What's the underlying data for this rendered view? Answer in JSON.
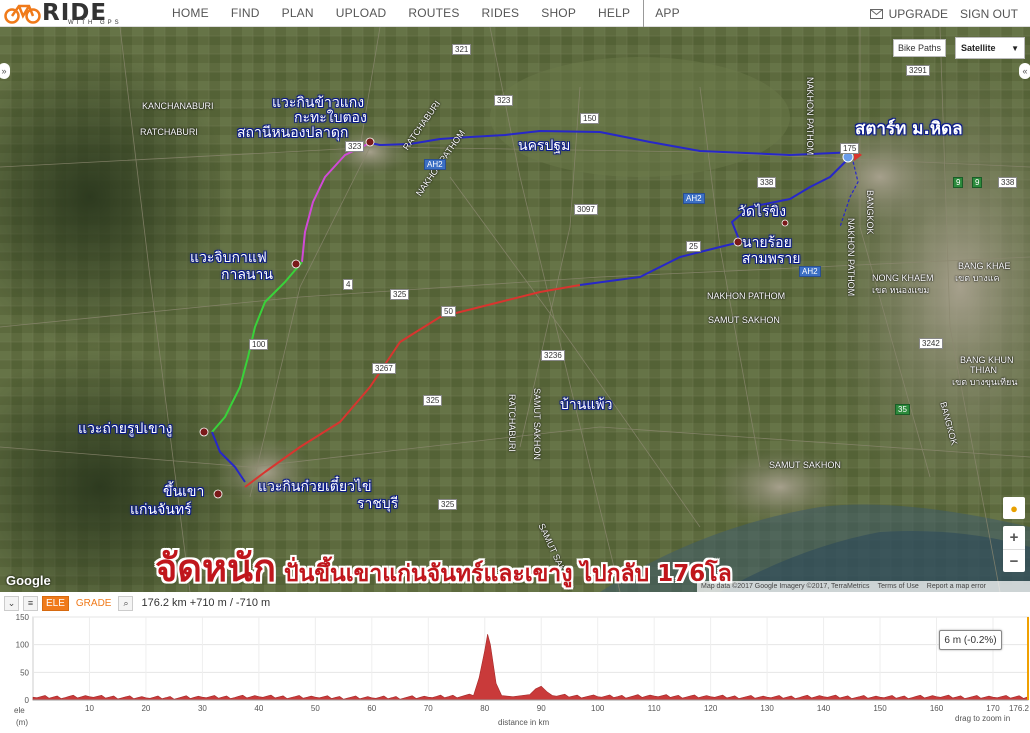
{
  "header": {
    "logo_text": "RIDE",
    "logo_sub": "WITH GPS",
    "nav": [
      "HOME",
      "FIND",
      "PLAN",
      "UPLOAD",
      "ROUTES",
      "RIDES",
      "SHOP",
      "HELP"
    ],
    "app_label": "APP",
    "upgrade_label": "UPGRADE",
    "signout_label": "SIGN OUT"
  },
  "map": {
    "bike_paths_label": "Bike Paths",
    "map_type_selected": "Satellite",
    "google_label": "Google",
    "attribution": [
      "Map data ©2017 Google Imagery ©2017, TerraMetrics",
      "Terms of Use",
      "Report a map error"
    ],
    "place_labels": {
      "kanchanaburi1": "KANCHANABURI",
      "kanchanaburi2": "RATCHABURI",
      "nakhon_pathom_top": "NAKHON PATHOM",
      "nakhon_pathom_mid": "NAKHON PATHOM",
      "nakhon_pathom_right": "NAKHON PATHOM",
      "bangkok": "BANGKOK",
      "nong_khaem": "NONG KHAEM",
      "nong_khaem_th": "เขต หนองแขม",
      "bang_khae": "BANG KHAE",
      "bang_khae_th": "เขต บางแค",
      "samut_sakhon1": "SAMUT SAKHON",
      "samut_sakhon2": "SAMUT SAKHON",
      "samut_sakhon3": "SAMUT SAKHON",
      "samut_sakhon4": "SAMUT SAKHON",
      "ratchaburi1": "RATCHABURI",
      "ratchaburi2": "RATCHABURI",
      "bang_khun_thian": "BANG KHUN",
      "thian": "THIAN",
      "bang_khun_th": "เขต บางขุนเทียน",
      "bangkok2": "BANGKOK",
      "nakhon_pathom_vert": "NAKHON PATHOM"
    },
    "annotations": {
      "start": "สตาร์ท ม.หิดล",
      "nakhon_pathom_th": "นครปฐม",
      "wat_rai_khing": "วัดไร่ขิง",
      "nai_roi1": "นายร้อย",
      "nai_roi2": "สามพราย",
      "rice_stop1": "แวะกินข้าวแกง",
      "rice_stop2": "กะทะใบตอง",
      "rice_stop3": "สถานีหนองปลาดุก",
      "coffee1": "แวะจิบกาแฟ",
      "coffee2": "กาลนาน",
      "photo_stop": "แวะถ่ายรูปเขางู",
      "climb1": "ขึ้นเขา",
      "climb2": "แก่นจันทร์",
      "noodle1": "แวะกินก๋วยเตี๋ยวไข่",
      "noodle2": "ราชบุรี",
      "ban_phaeo": "บ้านแพ้ว"
    },
    "shields": [
      "321",
      "323",
      "323",
      "150",
      "AH2",
      "AH2",
      "3097",
      "338",
      "338",
      "9",
      "9",
      "175",
      "25",
      "AH2",
      "4",
      "325",
      "50",
      "100",
      "3267",
      "3236",
      "3242",
      "325",
      "35",
      "325",
      "3291"
    ],
    "title_big": "จัดหนัก",
    "title_small": " ปั่นขึ้นเขาแก่นจันทร์และเขางู ไปกลับ 176โล",
    "colors": {
      "route_blue": "#2727c9",
      "route_red": "#d8352f",
      "route_green": "#39d23a",
      "route_magenta": "#d14ad7"
    }
  },
  "elevation": {
    "ele_label": "ELE",
    "grade_label": "GRADE",
    "summary": "176.2 km +710 m / -710 m",
    "tooltip": "6 m (-0.2%)",
    "y_axis_title": "ele",
    "y_axis_unit": "(m)",
    "x_axis_title": "distance in km",
    "hint": "drag to zoom in",
    "y_ticks": [
      "150",
      "100",
      "50",
      "0"
    ],
    "x_ticks": [
      "10",
      "20",
      "30",
      "40",
      "50",
      "60",
      "70",
      "80",
      "90",
      "100",
      "110",
      "120",
      "130",
      "140",
      "150",
      "160",
      "170"
    ],
    "x_end_label": "176.2",
    "chart_data": {
      "type": "area",
      "x": [
        0,
        10,
        20,
        30,
        40,
        50,
        60,
        70,
        78,
        79,
        80,
        80.5,
        81,
        82,
        83,
        85,
        88,
        89,
        90,
        91,
        92,
        100,
        110,
        120,
        130,
        140,
        150,
        160,
        170,
        176.2
      ],
      "y": [
        5,
        6,
        4,
        5,
        6,
        5,
        4,
        5,
        8,
        40,
        90,
        119,
        100,
        30,
        8,
        6,
        10,
        20,
        25,
        15,
        8,
        6,
        7,
        6,
        5,
        6,
        5,
        6,
        5,
        6
      ],
      "xlim": [
        0,
        176.2
      ],
      "ylim": [
        0,
        150
      ],
      "xlabel": "distance in km",
      "ylabel": "ele (m)"
    }
  }
}
